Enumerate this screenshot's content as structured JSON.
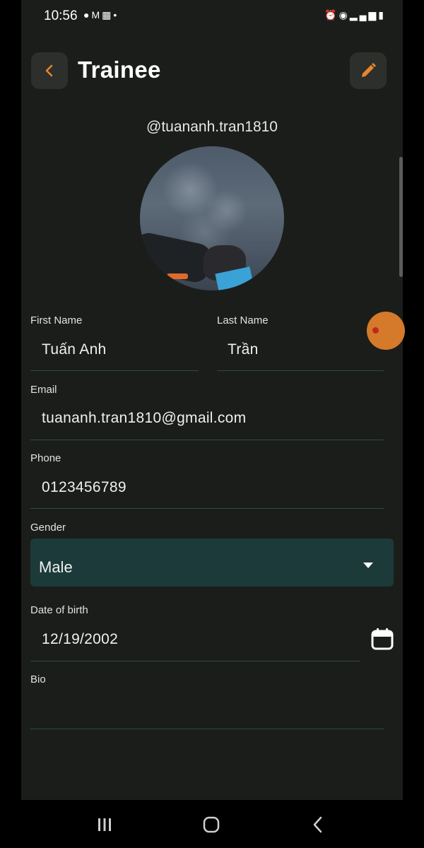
{
  "status_bar": {
    "time": "10:56",
    "left_icons": [
      "gallery-icon",
      "gmail-icon",
      "team-icon",
      "dot-icon"
    ],
    "right_icons": [
      "alarm-icon",
      "hotspot-icon",
      "volte-icon",
      "4g-icon",
      "signal-icon",
      "battery-icon"
    ]
  },
  "header": {
    "title": "Trainee",
    "back_icon": "chevron-left-icon",
    "edit_icon": "pencil-icon"
  },
  "profile": {
    "username": "@tuananh.tran1810"
  },
  "form": {
    "first_name": {
      "label": "First Name",
      "value": "Tuấn Anh"
    },
    "last_name": {
      "label": "Last Name",
      "value": "Trần"
    },
    "email": {
      "label": "Email",
      "value": "tuananh.tran1810@gmail.com"
    },
    "phone": {
      "label": "Phone",
      "value": "0123456789"
    },
    "gender": {
      "label": "Gender",
      "value": "Male"
    },
    "dob": {
      "label": "Date of birth",
      "value": "12/19/2002"
    },
    "bio": {
      "label": "Bio",
      "value": ""
    }
  },
  "colors": {
    "background": "#1b1d1a",
    "accent": "#e8862a",
    "select_bg": "#1c3a3a",
    "divider": "#2f4a44"
  },
  "nav": {
    "recent_icon": "recent-apps-icon",
    "home_icon": "home-icon",
    "back_icon": "back-icon"
  }
}
